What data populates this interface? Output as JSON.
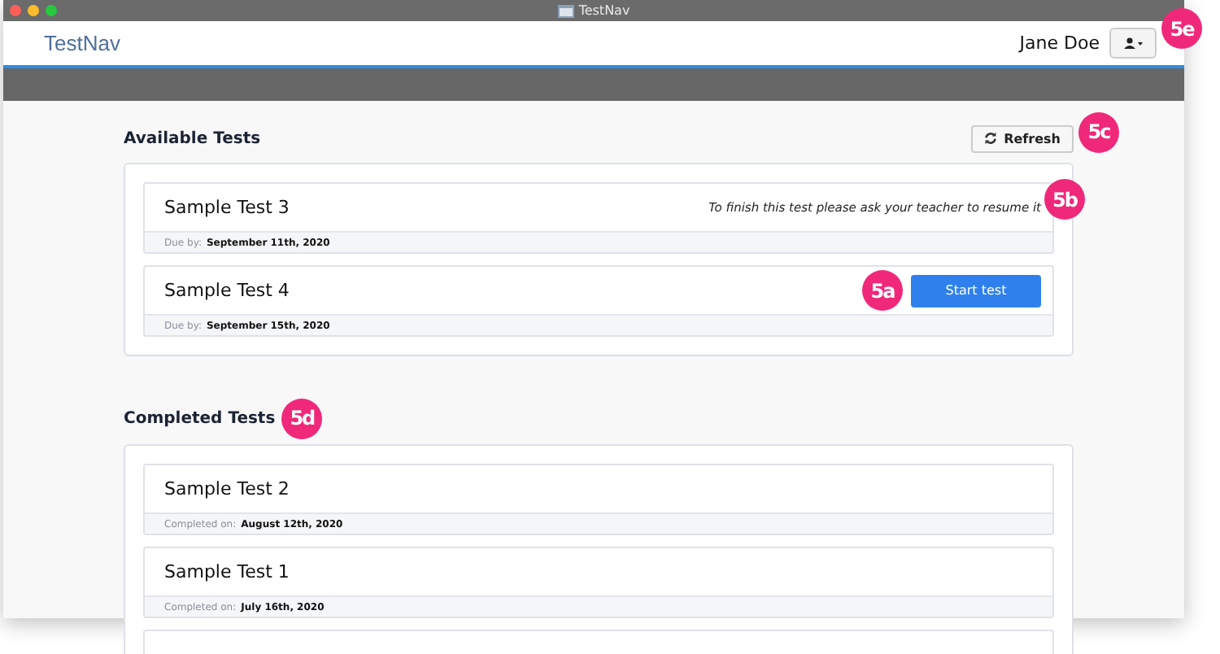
{
  "window": {
    "title": "TestNav"
  },
  "header": {
    "logo": "TestNav",
    "user_name": "Jane Doe",
    "callout": "5e"
  },
  "available": {
    "heading": "Available Tests",
    "refresh": {
      "label": "Refresh",
      "callout": "5c"
    },
    "tests": [
      {
        "name": "Sample Test 3",
        "kind": "resume",
        "message": "To finish this test please ask your teacher to resume it",
        "callout": "5b",
        "meta_label": "Due by:",
        "meta_value": "September 11th, 2020"
      },
      {
        "name": "Sample Test 4",
        "kind": "start",
        "button": "Start test",
        "callout": "5a",
        "meta_label": "Due by:",
        "meta_value": "September 15th, 2020"
      }
    ]
  },
  "completed": {
    "heading": "Completed Tests",
    "callout": "5d",
    "tests": [
      {
        "name": "Sample Test 2",
        "meta_label": "Completed on:",
        "meta_value": "August 12th, 2020"
      },
      {
        "name": "Sample Test 1",
        "meta_label": "Completed on:",
        "meta_value": "July 16th, 2020"
      }
    ]
  }
}
